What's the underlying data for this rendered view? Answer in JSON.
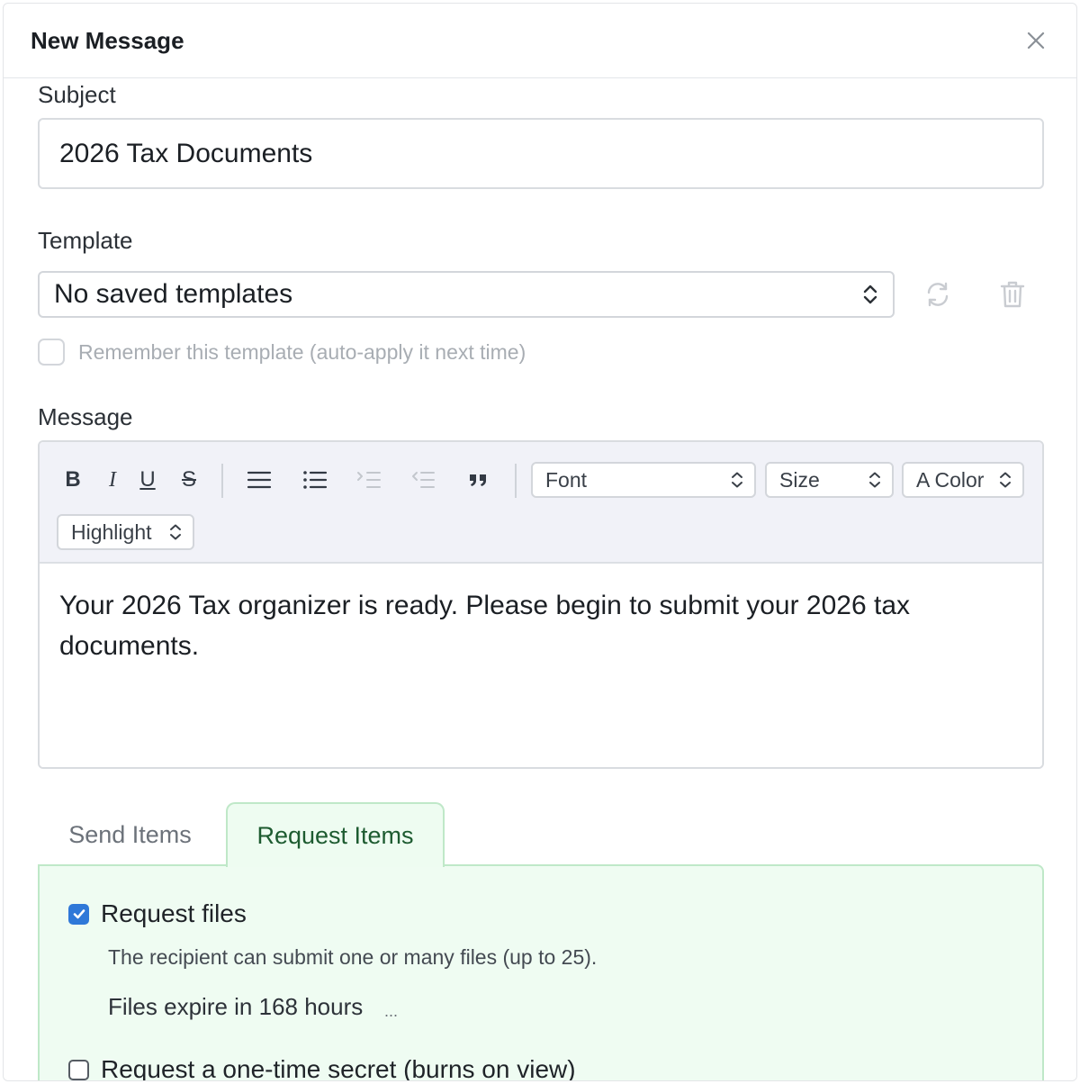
{
  "header": {
    "title": "New Message"
  },
  "subject": {
    "label": "Subject",
    "value": "2026 Tax Documents"
  },
  "template": {
    "label": "Template",
    "selected": "No saved templates",
    "remember_label": "Remember this template (auto-apply it next time)",
    "remember_checked": false
  },
  "message": {
    "label": "Message",
    "toolbar": {
      "bold": "B",
      "italic": "I",
      "underline": "U",
      "strike": "S",
      "font_select": "Font",
      "size_select": "Size",
      "color_select": "A Color",
      "highlight_select": "Highlight"
    },
    "body": "Your 2026 Tax organizer is ready. Please begin to submit your 2026 tax documents."
  },
  "tabs": [
    {
      "label": "Send Items",
      "active": false
    },
    {
      "label": "Request Items",
      "active": true
    }
  ],
  "request_panel": {
    "request_files_label": "Request files",
    "request_files_checked": true,
    "request_files_desc": "The recipient can submit one or many files (up to 25).",
    "expire_text": "Files expire in 168 hours",
    "expire_more": "...",
    "secret_label": "Request a one-time secret (burns on view)",
    "secret_checked": false
  },
  "colors": {
    "checkbox_accent": "#2f78d8",
    "active_tab_bg": "#eefcf1",
    "active_tab_text": "#1d5b30",
    "toolbar_bg": "#f1f2f8"
  }
}
